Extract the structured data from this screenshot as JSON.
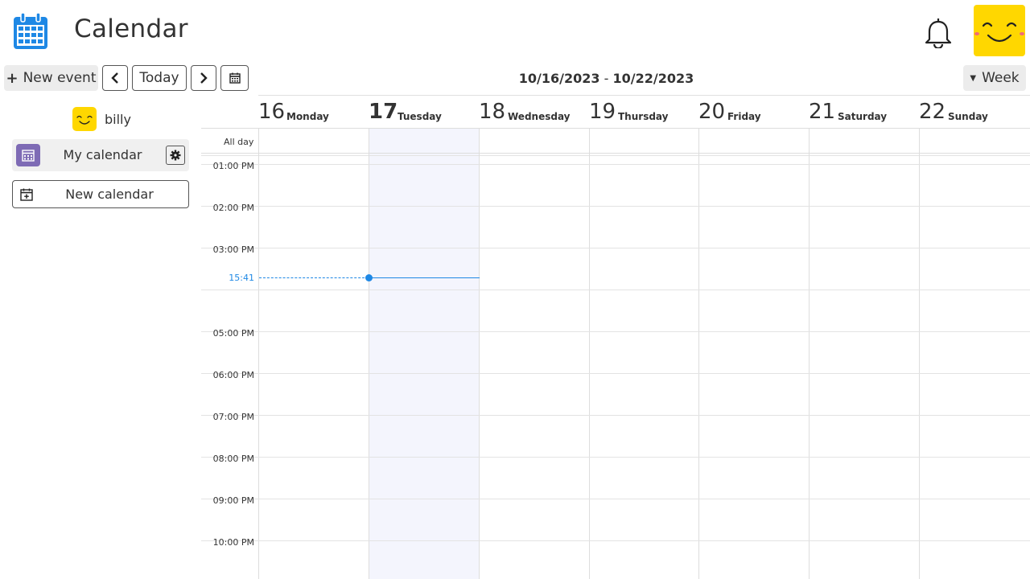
{
  "header": {
    "title": "Calendar",
    "icons": {
      "app": "calendar-icon",
      "notifications": "bell-icon",
      "user": "smiley-avatar"
    }
  },
  "toolbar": {
    "new_event_label": "New event",
    "today_label": "Today",
    "range_start": "10/16/2023",
    "range_sep": " - ",
    "range_end": "10/22/2023",
    "view_label": "Week"
  },
  "sidebar": {
    "user_name": "billy",
    "calendars": [
      {
        "label": "My calendar",
        "color": "#7e6bb5"
      }
    ],
    "new_calendar_label": "New calendar"
  },
  "calendar": {
    "days": [
      {
        "num": "16",
        "name": "Monday"
      },
      {
        "num": "17",
        "name": "Tuesday",
        "today": true
      },
      {
        "num": "18",
        "name": "Wednesday"
      },
      {
        "num": "19",
        "name": "Thursday"
      },
      {
        "num": "20",
        "name": "Friday"
      },
      {
        "num": "21",
        "name": "Saturday"
      },
      {
        "num": "22",
        "name": "Sunday"
      }
    ],
    "all_day_label": "All day",
    "hours": [
      "01:00 PM",
      "02:00 PM",
      "03:00 PM",
      "05:00 PM",
      "06:00 PM",
      "07:00 PM",
      "08:00 PM",
      "09:00 PM",
      "10:00 PM"
    ],
    "now_time": "15:41",
    "accent_color": "#1e88e5",
    "today_bg": "#f4f5fd"
  }
}
